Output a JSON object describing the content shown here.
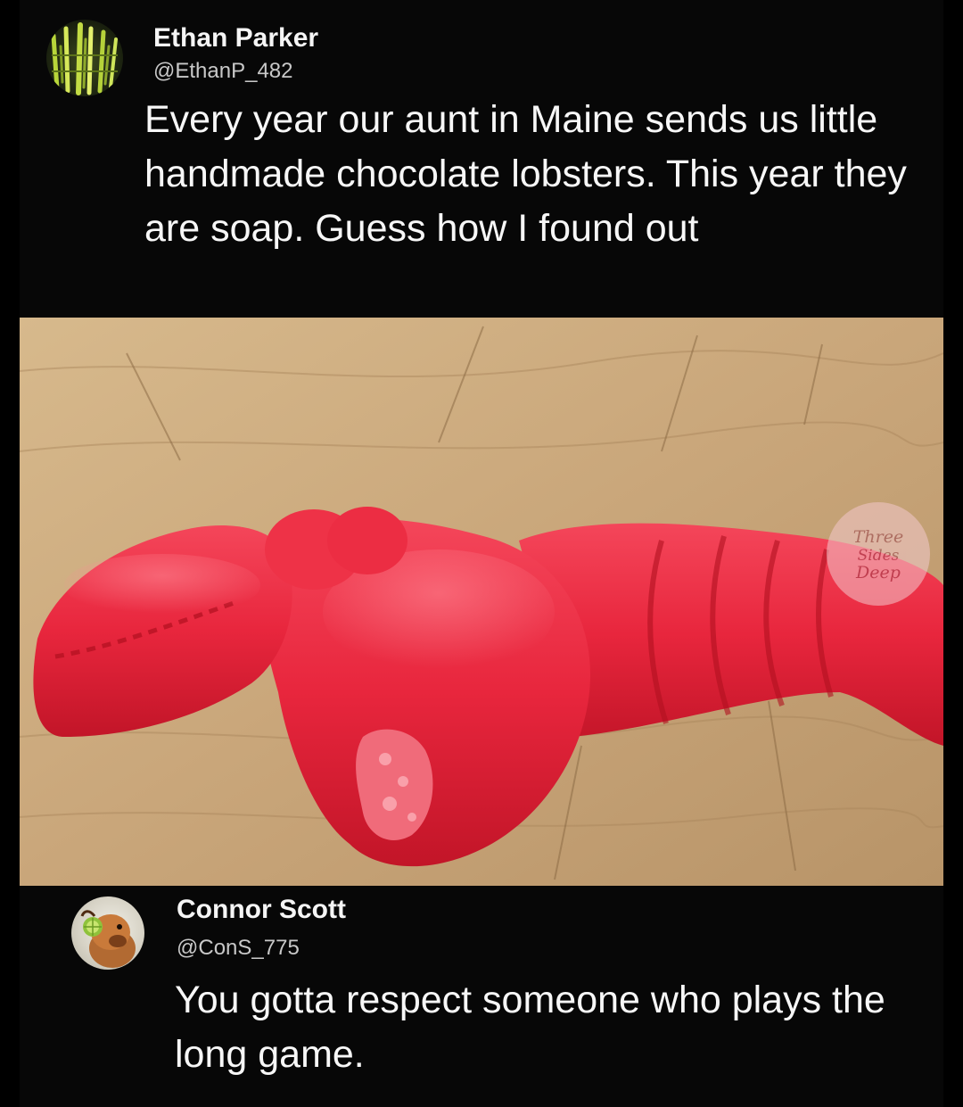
{
  "tweet": {
    "author": {
      "name": "Ethan Parker",
      "handle": "@EthanP_482",
      "avatar": "bamboo-grass-avatar"
    },
    "text": "Every year our aunt in Maine sends us little handmade chocolate lobsters. This year they are soap. Guess how I found out",
    "photo": {
      "subject": "red-lobster-shaped-soap-with-bite-mark",
      "watermark": "Three Sides Deep"
    }
  },
  "reply": {
    "author": {
      "name": "Connor Scott",
      "handle": "@ConS_775",
      "avatar": "dog-with-lime-avatar"
    },
    "text": "You gotta respect someone who plays the long game."
  },
  "colors": {
    "background": "#000000",
    "panel": "#070707",
    "text": "#f7f7f7",
    "handle": "#c8c8c8",
    "soap_red": "#e8263d",
    "wood": "#c9a67a"
  }
}
